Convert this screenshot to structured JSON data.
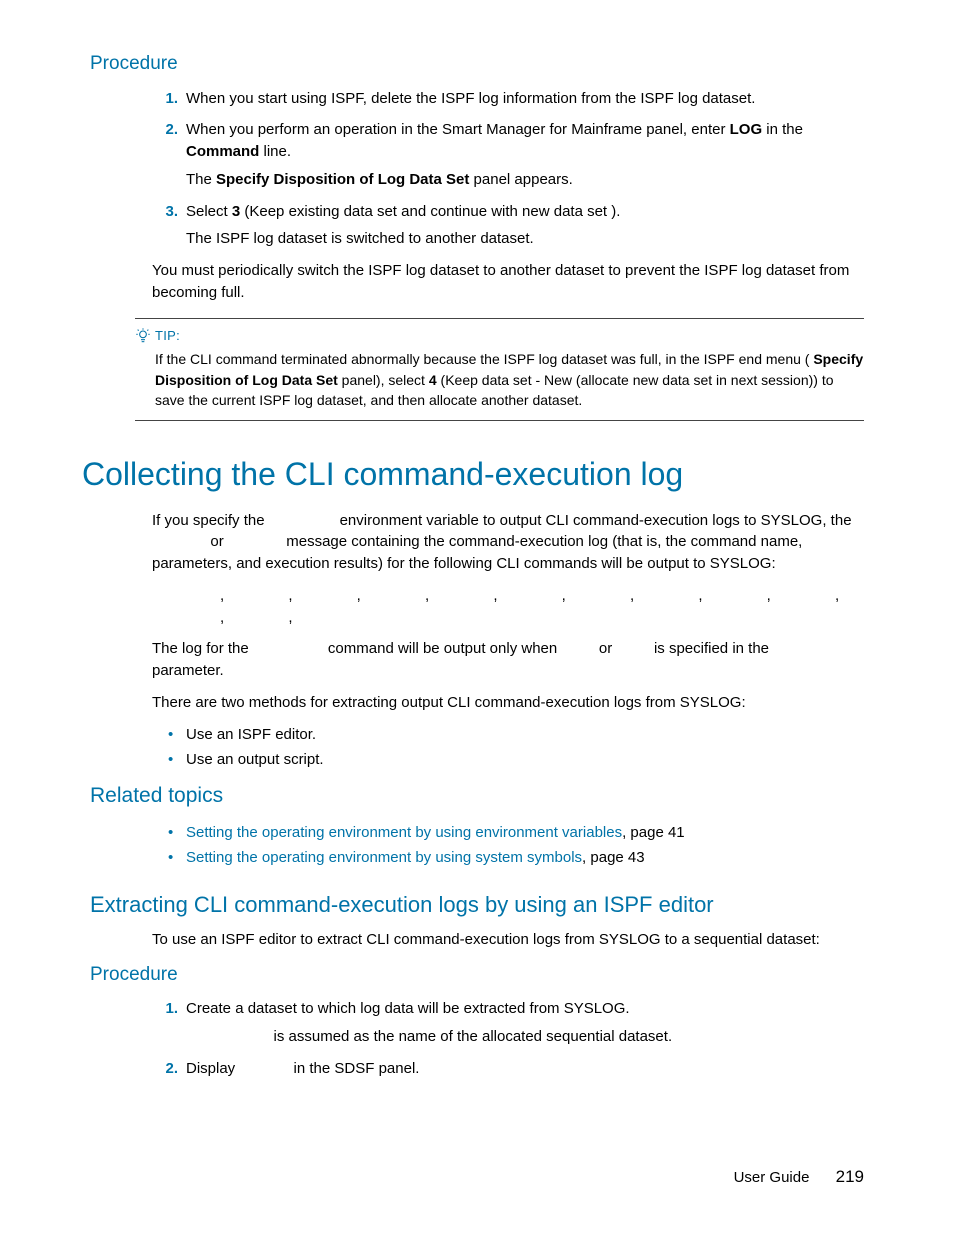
{
  "sec1": {
    "heading": "Procedure",
    "step1": "When you start using ISPF, delete the ISPF log information from the ISPF log dataset.",
    "step2_a": "When you perform an operation in the Smart Manager for Mainframe panel, enter ",
    "step2_b": "LOG",
    "step2_c": " in the ",
    "step2_d": "Command",
    "step2_e": " line.",
    "step2_follow_a": "The ",
    "step2_follow_b": "Specify Disposition of Log Data Set",
    "step2_follow_c": " panel appears.",
    "step3_a": "Select ",
    "step3_b": "3",
    "step3_c": " (Keep existing data set and continue with new data set ).",
    "step3_follow": "The ISPF log dataset is switched to another dataset.",
    "after": "You must periodically switch the ISPF log dataset to another dataset to prevent the ISPF log dataset from becoming full."
  },
  "tip": {
    "label": "TIP:",
    "body_a": "If the CLI command terminated abnormally because the ISPF log dataset was full, in the ISPF end menu ( ",
    "body_b": "Specify Disposition of Log Data Set",
    "body_c": " panel), select ",
    "body_d": "4",
    "body_e": " (Keep data set - New (allocate new data set in next session)) to save the current ISPF log dataset, and then allocate another dataset."
  },
  "sec2": {
    "heading": "Collecting the CLI command-execution log",
    "p1_a": "If you specify the ",
    "p1_b": " environment variable to output CLI command-execution logs to SYSLOG, the ",
    "p1_c": " or ",
    "p1_d": " message containing the command-execution log (that is, the command name, parameters, and execution results) for the following CLI commands will be output to SYSLOG:",
    "p2": ", , , , , , , , , , , , ",
    "p3_a": "The log for the ",
    "p3_b": " command will be output only when ",
    "p3_c": " or ",
    "p3_d": " is specified in the ",
    "p3_e": " parameter.",
    "p4": "There are two methods for extracting output CLI command-execution logs from SYSLOG:",
    "bul1": "Use an ISPF editor.",
    "bul2": "Use an output script."
  },
  "related": {
    "heading": "Related topics",
    "l1_text": "Setting the operating environment by using environment variables",
    "l1_suffix": ", page 41",
    "l2_text": "Setting the operating environment by using system symbols",
    "l2_suffix": ", page 43"
  },
  "sec3": {
    "heading": "Extracting CLI command-execution logs by using an ISPF editor",
    "p1": "To use an ISPF editor to extract CLI command-execution logs from SYSLOG to a sequential dataset:"
  },
  "sec4": {
    "heading": "Procedure",
    "step1": "Create a dataset to which log data will be extracted from SYSLOG.",
    "step1_follow": " is assumed as the name of the allocated sequential dataset.",
    "step2_a": "Display ",
    "step2_b": " in the SDSF panel."
  },
  "footer": {
    "label": "User Guide",
    "page": "219"
  }
}
